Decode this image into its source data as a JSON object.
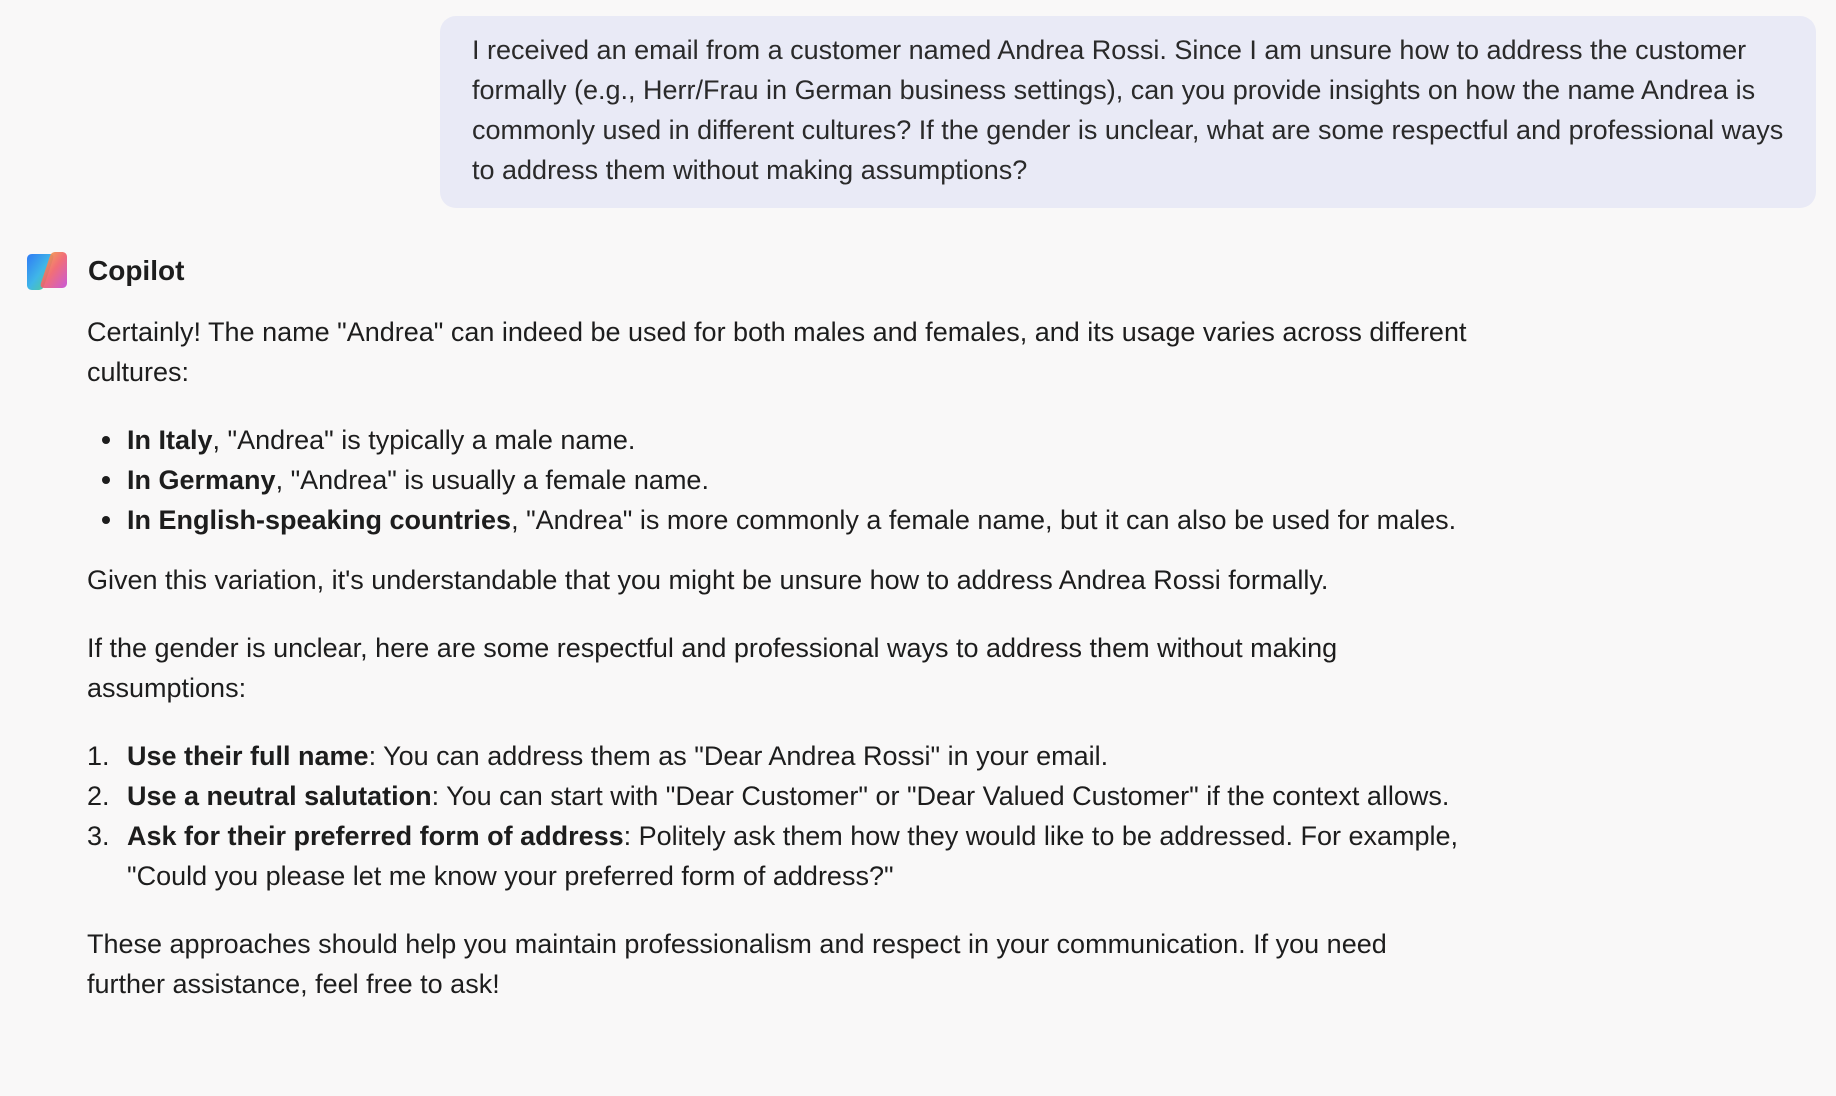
{
  "user_message": "I received an email from a customer named Andrea Rossi. Since I am unsure how to address the customer formally (e.g., Herr/Frau in German business settings), can you provide insights on how the name Andrea is commonly used in different cultures? If the gender is unclear, what are some respectful and professional ways to address them without making assumptions?",
  "assistant": {
    "name": "Copilot",
    "logo_icon": "copilot-logo-icon",
    "intro": "Certainly! The name \"Andrea\" can indeed be used for both males and females, and its usage varies across different cultures:",
    "bullets": [
      {
        "bold": "In Italy",
        "text": ", \"Andrea\" is typically a male name."
      },
      {
        "bold": "In Germany",
        "text": ", \"Andrea\" is usually a female name."
      },
      {
        "bold": "In English-speaking countries",
        "text": ", \"Andrea\" is more commonly a female name, but it can also be used for males."
      }
    ],
    "variation_note": "Given this variation, it's understandable that you might be unsure how to address Andrea Rossi formally.",
    "ways_intro": "If the gender is unclear, here are some respectful and professional ways to address them without making assumptions:",
    "steps": [
      {
        "num": "1.",
        "bold": "Use their full name",
        "text": ": You can address them as \"Dear Andrea Rossi\" in your email."
      },
      {
        "num": "2.",
        "bold": "Use a neutral salutation",
        "text": ": You can start with \"Dear Customer\" or \"Dear Valued Customer\" if the context allows."
      },
      {
        "num": "3.",
        "bold": "Ask for their preferred form of address",
        "text": ": Politely ask them how they would like to be addressed. For example, \"Could you please let me know your preferred form of address?\""
      }
    ],
    "closing": "These approaches should help you maintain professionalism and respect in your communication. If you need further assistance, feel free to ask!"
  },
  "colors": {
    "background": "#f9f8f8",
    "user_bubble": "#e9eaf6",
    "text": "#1d1d1d"
  }
}
